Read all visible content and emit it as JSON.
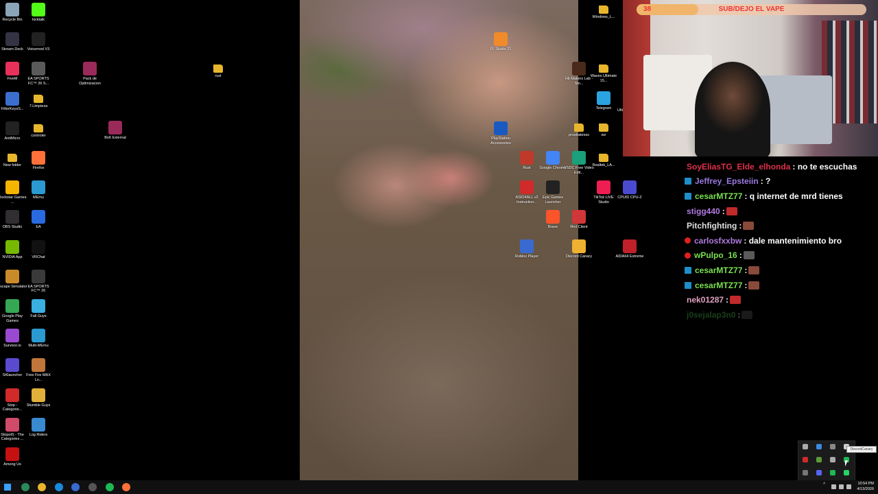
{
  "desktop": {
    "icons_col1": [
      {
        "label": "Recycle Bin",
        "icon": "recycle-bin-icon",
        "color": "#8aa4b8"
      },
      {
        "label": "Stream Deck",
        "icon": "stream-deck-icon",
        "color": "#333344"
      },
      {
        "label": "FiveM",
        "icon": "fivem-icon",
        "color": "#e8315a"
      },
      {
        "label": "FilterKeysS...",
        "icon": "app-icon",
        "color": "#3c6ecf"
      },
      {
        "label": "AntiMicro",
        "icon": "gamepad-icon",
        "color": "#222222"
      },
      {
        "label": "New folder",
        "icon": "folder-icon",
        "color": "#e8b62c"
      },
      {
        "label": "Rockstar Games ...",
        "icon": "rockstar-icon",
        "color": "#f4b400"
      },
      {
        "label": "OBS Studio",
        "icon": "obs-icon",
        "color": "#302e31"
      },
      {
        "label": "NVIDIA App",
        "icon": "nvidia-icon",
        "color": "#76b900"
      },
      {
        "label": "Escape Simulator",
        "icon": "game-icon",
        "color": "#c98a2a"
      },
      {
        "label": "Google Play Games",
        "icon": "google-play-icon",
        "color": "#34a853"
      },
      {
        "label": "Survivor.io",
        "icon": "game-icon",
        "color": "#9a4ad0"
      },
      {
        "label": "SKlauncher",
        "icon": "launcher-icon",
        "color": "#5a4ad0"
      },
      {
        "label": "Stop - Categorie...",
        "icon": "game-icon",
        "color": "#d02a2a"
      },
      {
        "label": "StopotS - The Categories ...",
        "icon": "game-icon",
        "color": "#d04a6a"
      },
      {
        "label": "Among Us",
        "icon": "among-us-icon",
        "color": "#c51111"
      }
    ],
    "icons_col2": [
      {
        "label": "kicktalk",
        "icon": "kick-icon",
        "color": "#53fc18"
      },
      {
        "label": "Voicemod V3",
        "icon": "voicemod-icon",
        "color": "#222222"
      },
      {
        "label": "EA SPORTS FC™ 26 S...",
        "icon": "game-icon",
        "color": "#5a5a5a"
      },
      {
        "label": "7.Limpieza",
        "icon": "folder-icon",
        "color": "#e8b62c"
      },
      {
        "label": "controler",
        "icon": "folder-icon",
        "color": "#e8b62c"
      },
      {
        "label": "Firefox",
        "icon": "firefox-icon",
        "color": "#ff7139"
      },
      {
        "label": "MEmu",
        "icon": "memu-icon",
        "color": "#2a9ad0"
      },
      {
        "label": "EA",
        "icon": "ea-icon",
        "color": "#2a6ae0"
      },
      {
        "label": "VRChat",
        "icon": "vrchat-icon",
        "color": "#111111"
      },
      {
        "label": "EA SPORTS FC™ 26",
        "icon": "game-icon",
        "color": "#3a3a3a"
      },
      {
        "label": "Fall Guys",
        "icon": "game-icon",
        "color": "#3ab0e0"
      },
      {
        "label": "Multi-MEmu",
        "icon": "memu-icon",
        "color": "#2a9ad0"
      },
      {
        "label": "Free Fire MAX Lo...",
        "icon": "game-icon",
        "color": "#c0763a"
      },
      {
        "label": "Stumble Guys",
        "icon": "game-icon",
        "color": "#e0b03a"
      },
      {
        "label": "Log Riders",
        "icon": "game-icon",
        "color": "#3a8ad0"
      }
    ],
    "icons_misc": [
      {
        "label": "Pack de Optimizacion",
        "icon": "winrar-icon",
        "color": "#9a2a5a"
      },
      {
        "label": "Bo6 External",
        "icon": "winrar-icon",
        "color": "#9a2a5a"
      },
      {
        "label": "rust",
        "icon": "folder-icon",
        "color": "#e8b62c"
      }
    ],
    "icons_right": [
      {
        "label": "FL Studio 21",
        "icon": "fl-studio-icon",
        "color": "#f08a2a"
      },
      {
        "label": "PlayStation Accessories",
        "icon": "playstation-icon",
        "color": "#1a5ac0"
      },
      {
        "label": "Rust",
        "icon": "rust-icon",
        "color": "#c0392b"
      },
      {
        "label": "Google Chrome",
        "icon": "chrome-icon",
        "color": "#4285f4"
      },
      {
        "label": "VSDC Free Video Edit...",
        "icon": "vsdc-icon",
        "color": "#1aa07a"
      },
      {
        "label": "ASIO4ALL v2 Instruction...",
        "icon": "pdf-icon",
        "color": "#d02a2a"
      },
      {
        "label": "Epic Games Launcher",
        "icon": "epic-icon",
        "color": "#222222"
      },
      {
        "label": "Brave",
        "icon": "brave-icon",
        "color": "#fb542b"
      },
      {
        "label": "Riot Client",
        "icon": "riot-icon",
        "color": "#d13639"
      },
      {
        "label": "Roblox Player",
        "icon": "roblox-icon",
        "color": "#3a6ad0"
      },
      {
        "label": "Discord Canary",
        "icon": "discord-canary-icon",
        "color": "#f0b030"
      },
      {
        "label": "Hit Makers Lab - Sto...",
        "icon": "app-icon",
        "color": "#4a2a1a"
      },
      {
        "label": "pruebatesss",
        "icon": "folder-icon",
        "color": "#e8b62c"
      },
      {
        "label": "Windows_L...",
        "icon": "folder-icon",
        "color": "#e8b62c"
      },
      {
        "label": "Waves Ultimate 15...",
        "icon": "folder-icon",
        "color": "#e8b62c"
      },
      {
        "label": "Telegram",
        "icon": "telegram-icon",
        "color": "#2aa3e0"
      },
      {
        "label": "wz",
        "icon": "folder-icon",
        "color": "#e8b62c"
      },
      {
        "label": "Realtek_LA...",
        "icon": "folder-icon",
        "color": "#e8b62c"
      },
      {
        "label": "TikTok LIVE Studio",
        "icon": "tiktok-icon",
        "color": "#ee1d52"
      },
      {
        "label": "CPUID CPU-Z",
        "icon": "cpuz-icon",
        "color": "#4a4ad0"
      },
      {
        "label": "AIDA64 Extreme",
        "icon": "aida64-icon",
        "color": "#c0202a"
      }
    ],
    "edge_label": "Ulti"
  },
  "stream": {
    "goal_count": "38",
    "goal_text": "SUB/DEJO EL VAPE",
    "goal_progress": 0.27
  },
  "chat": [
    {
      "user": "SoyEliasTG_Elde_elhonda",
      "color": "#e0304a",
      "badge": "none",
      "text": ": no te escuchas",
      "emote": ""
    },
    {
      "user": "Jeffrey_Epsteiin",
      "color": "#9a7ae0",
      "badge": "square",
      "text": ": ?",
      "emote": ""
    },
    {
      "user": "cesarMTZ77",
      "color": "#7ae050",
      "badge": "square",
      "text": ": q internet de mrd tienes",
      "emote": ""
    },
    {
      "user": "stigg440",
      "color": "#b07ae0",
      "badge": "none",
      "text": ":",
      "emote": "#c02a2a"
    },
    {
      "user": "Pitchfighting",
      "color": "#e0e0e0",
      "badge": "none",
      "text": ":",
      "emote": "#8a4a3a"
    },
    {
      "user": "carlosfxxbw",
      "color": "#b07ae0",
      "badge": "dot",
      "text": ": dale mantenimiento bro",
      "emote": ""
    },
    {
      "user": "wPulpo_16",
      "color": "#7ae050",
      "badge": "dot",
      "text": ":",
      "emote": "#5a5a5a"
    },
    {
      "user": "cesarMTZ77",
      "color": "#7ae050",
      "badge": "square",
      "text": ":",
      "emote": "#8a4a3a"
    },
    {
      "user": "cesarMTZ77",
      "color": "#7ae050",
      "badge": "square",
      "text": ":",
      "emote": "#8a4a3a"
    },
    {
      "user": "nek01287",
      "color": "#e0a0c0",
      "badge": "none",
      "text": ":",
      "emote": "#c02a2a"
    },
    {
      "user": "j0sejalap3n0",
      "color": "#3a8a3a",
      "badge": "none",
      "text": ":",
      "emote": "#3a3a3a"
    }
  ],
  "tray": {
    "tooltip": "DiscordCanary"
  },
  "taskbar": {
    "time": "10:54 PM",
    "date": "4/13/2026",
    "pinned": [
      {
        "name": "windows-start-icon",
        "color": "#3aa0ff"
      },
      {
        "name": "terminal-icon",
        "color": "#2a8a5a"
      },
      {
        "name": "file-explorer-icon",
        "color": "#e8b62c"
      },
      {
        "name": "edge-icon",
        "color": "#1a8ae0"
      },
      {
        "name": "app-icon",
        "color": "#3a6ad0"
      },
      {
        "name": "obs-icon",
        "color": "#555555"
      },
      {
        "name": "spotify-icon",
        "color": "#1db954"
      },
      {
        "name": "firefox-icon",
        "color": "#ff7139"
      }
    ]
  }
}
